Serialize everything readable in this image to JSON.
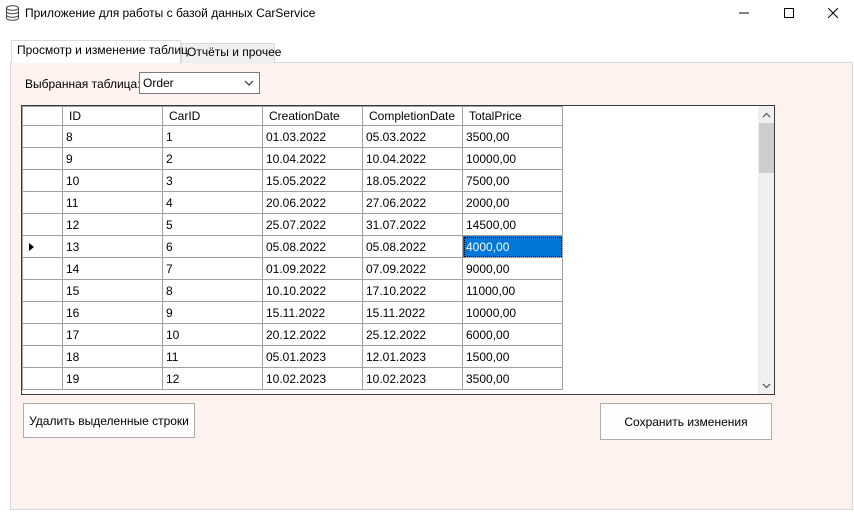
{
  "window": {
    "title": "Приложение для работы с базой данных CarService",
    "icon": "database-icon"
  },
  "tabs": [
    {
      "label": "Просмотр и изменение таблиц",
      "active": true
    },
    {
      "label": "Отчёты и прочее",
      "active": false
    }
  ],
  "table_selector": {
    "label": "Выбранная таблица:",
    "value": "Order"
  },
  "grid": {
    "columns": [
      "ID",
      "CarID",
      "CreationDate",
      "CompletionDate",
      "TotalPrice"
    ],
    "rows": [
      [
        "8",
        "1",
        "01.03.2022",
        "05.03.2022",
        "3500,00"
      ],
      [
        "9",
        "2",
        "10.04.2022",
        "10.04.2022",
        "10000,00"
      ],
      [
        "10",
        "3",
        "15.05.2022",
        "18.05.2022",
        "7500,00"
      ],
      [
        "11",
        "4",
        "20.06.2022",
        "27.06.2022",
        "2000,00"
      ],
      [
        "12",
        "5",
        "25.07.2022",
        "31.07.2022",
        "14500,00"
      ],
      [
        "13",
        "6",
        "05.08.2022",
        "05.08.2022",
        "4000,00"
      ],
      [
        "14",
        "7",
        "01.09.2022",
        "07.09.2022",
        "9000,00"
      ],
      [
        "15",
        "8",
        "10.10.2022",
        "17.10.2022",
        "11000,00"
      ],
      [
        "16",
        "9",
        "15.11.2022",
        "15.11.2022",
        "10000,00"
      ],
      [
        "17",
        "10",
        "20.12.2022",
        "25.12.2022",
        "6000,00"
      ],
      [
        "18",
        "11",
        "05.01.2023",
        "12.01.2023",
        "1500,00"
      ],
      [
        "19",
        "12",
        "10.02.2023",
        "10.02.2023",
        "3500,00"
      ]
    ],
    "current_row_index": 5,
    "selected_cell": {
      "row": 5,
      "column": 4
    },
    "selection_color": "#0078d7"
  },
  "buttons": {
    "delete_label": "Удалить выделенные строки",
    "save_label": "Сохранить изменения"
  },
  "colors": {
    "tabpage_background": "#fdf2ee"
  }
}
